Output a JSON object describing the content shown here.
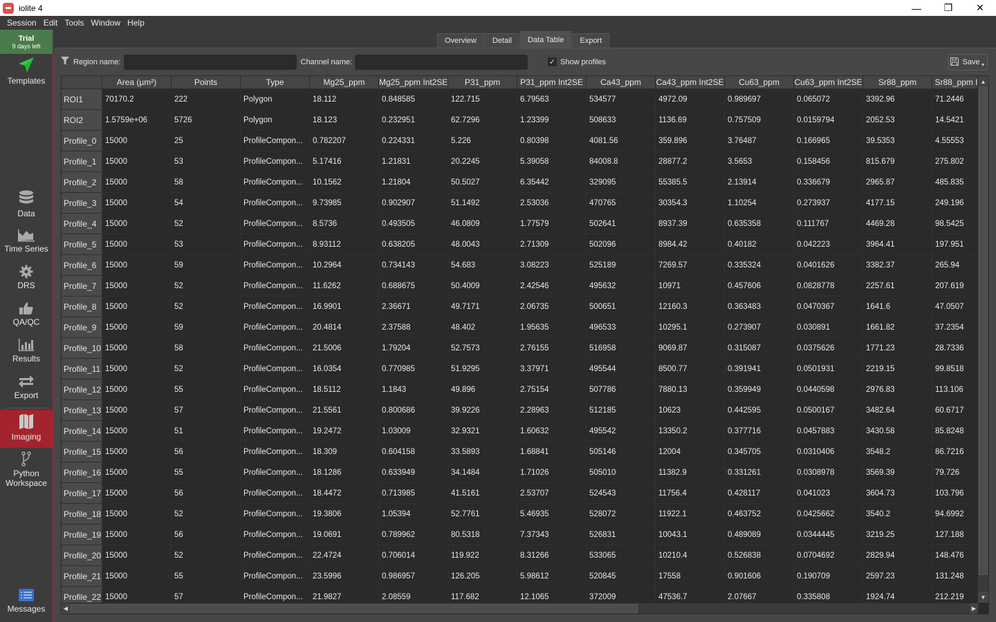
{
  "window": {
    "title": "iolite 4",
    "controls": {
      "minimize": "—",
      "maximize": "❐",
      "close": "✕"
    }
  },
  "menu": [
    "Session",
    "Edit",
    "Tools",
    "Window",
    "Help"
  ],
  "trial": {
    "title": "Trial",
    "subtitle": "9 days left"
  },
  "sidebar": {
    "items": [
      {
        "label": "Templates",
        "icon": "paper-plane-icon"
      },
      {
        "label": "Data",
        "icon": "database-icon"
      },
      {
        "label": "Time Series",
        "icon": "area-chart-icon"
      },
      {
        "label": "DRS",
        "icon": "gear-icon"
      },
      {
        "label": "QA/QC",
        "icon": "thumbs-up-icon"
      },
      {
        "label": "Results",
        "icon": "bar-chart-icon"
      },
      {
        "label": "Export",
        "icon": "swap-arrows-icon"
      },
      {
        "label": "Imaging",
        "icon": "map-icon",
        "active": true
      },
      {
        "label": "Python\nWorkspace",
        "label_line1": "Python",
        "label_line2": "Workspace",
        "icon": "git-branch-icon"
      },
      {
        "label": "Messages",
        "icon": "message-list-icon"
      }
    ]
  },
  "colors": {
    "accent": "#a3232f",
    "trial": "#4a7b4a",
    "templates_icon": "#2ecc40",
    "messages_icon": "#3b6fd1"
  },
  "tabs": [
    {
      "label": "Overview"
    },
    {
      "label": "Detail"
    },
    {
      "label": "Data Table",
      "active": true
    },
    {
      "label": "Export"
    }
  ],
  "filters": {
    "region_label": "Region name:",
    "region_value": "",
    "channel_label": "Channel name:",
    "channel_value": "",
    "show_profiles_label": "Show profiles",
    "show_profiles_checked": true,
    "save_label": "Save"
  },
  "table": {
    "columns": [
      "Area (µm²)",
      "Points",
      "Type",
      "Mg25_ppm",
      "Mg25_ppm Int2SE",
      "P31_ppm",
      "P31_ppm Int2SE",
      "Ca43_ppm",
      "Ca43_ppm Int2SE",
      "Cu63_ppm",
      "Cu63_ppm Int2SE",
      "Sr88_ppm",
      "Sr88_ppm I"
    ],
    "rows": [
      {
        "name": "ROI1",
        "cells": [
          "70170.2",
          "222",
          "Polygon",
          "18.112",
          "0.848585",
          "122.715",
          "6.79563",
          "534577",
          "4972.09",
          "0.989697",
          "0.065072",
          "3392.96",
          "71.2446"
        ]
      },
      {
        "name": "ROI2",
        "cells": [
          "1.5759e+06",
          "5726",
          "Polygon",
          "18.123",
          "0.232951",
          "62.7296",
          "1.23399",
          "508633",
          "1136.69",
          "0.757509",
          "0.0159794",
          "2052.53",
          "14.5421"
        ]
      },
      {
        "name": "Profile_0",
        "cells": [
          "15000",
          "25",
          "ProfileCompon...",
          "0.782207",
          "0.224331",
          "5.226",
          "0.80398",
          "4081.56",
          "359.896",
          "3.76487",
          "0.166965",
          "39.5353",
          "4.55553"
        ]
      },
      {
        "name": "Profile_1",
        "cells": [
          "15000",
          "53",
          "ProfileCompon...",
          "5.17416",
          "1.21831",
          "20.2245",
          "5.39058",
          "84008.8",
          "28877.2",
          "3.5653",
          "0.158456",
          "815.679",
          "275.802"
        ]
      },
      {
        "name": "Profile_2",
        "cells": [
          "15000",
          "58",
          "ProfileCompon...",
          "10.1562",
          "1.21804",
          "50.5027",
          "6.35442",
          "329095",
          "55385.5",
          "2.13914",
          "0.336679",
          "2965.87",
          "485.835"
        ]
      },
      {
        "name": "Profile_3",
        "cells": [
          "15000",
          "54",
          "ProfileCompon...",
          "9.73985",
          "0.902907",
          "51.1492",
          "2.53036",
          "470765",
          "30354.3",
          "1.10254",
          "0.273937",
          "4177.15",
          "249.196"
        ]
      },
      {
        "name": "Profile_4",
        "cells": [
          "15000",
          "52",
          "ProfileCompon...",
          "8.5736",
          "0.493505",
          "46.0809",
          "1.77579",
          "502641",
          "8937.39",
          "0.635358",
          "0.111767",
          "4469.28",
          "98.5425"
        ]
      },
      {
        "name": "Profile_5",
        "cells": [
          "15000",
          "53",
          "ProfileCompon...",
          "8.93112",
          "0.638205",
          "48.0043",
          "2.71309",
          "502096",
          "8984.42",
          "0.40182",
          "0.042223",
          "3964.41",
          "197.951"
        ]
      },
      {
        "name": "Profile_6",
        "cells": [
          "15000",
          "59",
          "ProfileCompon...",
          "10.2964",
          "0.734143",
          "54.683",
          "3.08223",
          "525189",
          "7269.57",
          "0.335324",
          "0.0401626",
          "3382.37",
          "265.94"
        ]
      },
      {
        "name": "Profile_7",
        "cells": [
          "15000",
          "52",
          "ProfileCompon...",
          "11.6262",
          "0.688675",
          "50.4009",
          "2.42546",
          "495632",
          "10971",
          "0.457606",
          "0.0828778",
          "2257.61",
          "207.619"
        ]
      },
      {
        "name": "Profile_8",
        "cells": [
          "15000",
          "52",
          "ProfileCompon...",
          "16.9901",
          "2.36671",
          "49.7171",
          "2.06735",
          "500651",
          "12160.3",
          "0.363483",
          "0.0470367",
          "1641.6",
          "47.0507"
        ]
      },
      {
        "name": "Profile_9",
        "cells": [
          "15000",
          "59",
          "ProfileCompon...",
          "20.4814",
          "2.37588",
          "48.402",
          "1.95635",
          "496533",
          "10295.1",
          "0.273907",
          "0.030891",
          "1661.82",
          "37.2354"
        ]
      },
      {
        "name": "Profile_10",
        "cells": [
          "15000",
          "58",
          "ProfileCompon...",
          "21.5006",
          "1.79204",
          "52.7573",
          "2.76155",
          "516958",
          "9069.87",
          "0.315087",
          "0.0375626",
          "1771.23",
          "28.7336"
        ]
      },
      {
        "name": "Profile_11",
        "cells": [
          "15000",
          "52",
          "ProfileCompon...",
          "16.0354",
          "0.770985",
          "51.9295",
          "3.37971",
          "495544",
          "8500.77",
          "0.391941",
          "0.0501931",
          "2219.15",
          "99.8518"
        ]
      },
      {
        "name": "Profile_12",
        "cells": [
          "15000",
          "55",
          "ProfileCompon...",
          "18.5112",
          "1.1843",
          "49.896",
          "2.75154",
          "507786",
          "7880.13",
          "0.359949",
          "0.0440598",
          "2976.83",
          "113.106"
        ]
      },
      {
        "name": "Profile_13",
        "cells": [
          "15000",
          "57",
          "ProfileCompon...",
          "21.5561",
          "0.800686",
          "39.9226",
          "2.28963",
          "512185",
          "10623",
          "0.442595",
          "0.0500167",
          "3482.64",
          "60.6717"
        ]
      },
      {
        "name": "Profile_14",
        "cells": [
          "15000",
          "51",
          "ProfileCompon...",
          "19.2472",
          "1.03009",
          "32.9321",
          "1.60632",
          "495542",
          "13350.2",
          "0.377716",
          "0.0457883",
          "3430.58",
          "85.8248"
        ]
      },
      {
        "name": "Profile_15",
        "cells": [
          "15000",
          "56",
          "ProfileCompon...",
          "18.309",
          "0.604158",
          "33.5893",
          "1.68841",
          "505146",
          "12004",
          "0.345705",
          "0.0310406",
          "3548.2",
          "86.7216"
        ]
      },
      {
        "name": "Profile_16",
        "cells": [
          "15000",
          "55",
          "ProfileCompon...",
          "18.1286",
          "0.633949",
          "34.1484",
          "1.71026",
          "505010",
          "11382.9",
          "0.331261",
          "0.0308978",
          "3569.39",
          "79.726"
        ]
      },
      {
        "name": "Profile_17",
        "cells": [
          "15000",
          "56",
          "ProfileCompon...",
          "18.4472",
          "0.713985",
          "41.5161",
          "2.53707",
          "524543",
          "11756.4",
          "0.428117",
          "0.041023",
          "3604.73",
          "103.796"
        ]
      },
      {
        "name": "Profile_18",
        "cells": [
          "15000",
          "52",
          "ProfileCompon...",
          "19.3806",
          "1.05394",
          "52.7761",
          "5.46935",
          "528072",
          "11922.1",
          "0.463752",
          "0.0425662",
          "3540.2",
          "94.6992"
        ]
      },
      {
        "name": "Profile_19",
        "cells": [
          "15000",
          "56",
          "ProfileCompon...",
          "19.0691",
          "0.789962",
          "80.5318",
          "7.37343",
          "526831",
          "10043.1",
          "0.489089",
          "0.0344445",
          "3219.25",
          "127.188"
        ]
      },
      {
        "name": "Profile_20",
        "cells": [
          "15000",
          "52",
          "ProfileCompon...",
          "22.4724",
          "0.706014",
          "119.922",
          "8.31266",
          "533065",
          "10210.4",
          "0.526838",
          "0.0704692",
          "2829.94",
          "148.476"
        ]
      },
      {
        "name": "Profile_21",
        "cells": [
          "15000",
          "55",
          "ProfileCompon...",
          "23.5996",
          "0.986957",
          "126.205",
          "5.98612",
          "520845",
          "17558",
          "0.901606",
          "0.190709",
          "2597.23",
          "131.248"
        ]
      },
      {
        "name": "Profile_22",
        "cells": [
          "15000",
          "57",
          "ProfileCompon...",
          "21.9827",
          "2.08559",
          "117.682",
          "12.1065",
          "372009",
          "47536.7",
          "2.07667",
          "0.335808",
          "1924.74",
          "212.219"
        ]
      }
    ]
  }
}
